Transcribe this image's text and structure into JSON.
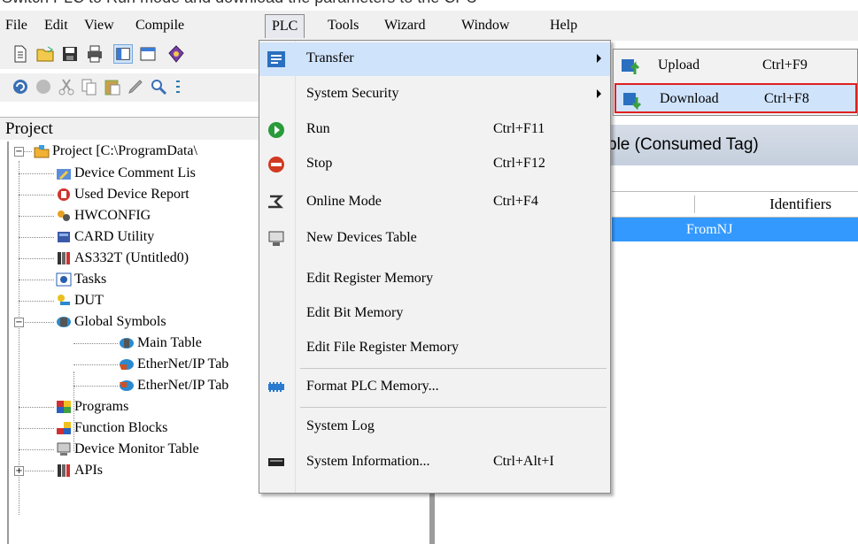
{
  "top_caption": "Switch PLC to Run mode and download the parameters to the CPU",
  "menubar": {
    "items": [
      "File",
      "Edit",
      "View",
      "Compile",
      "PLC",
      "Tools",
      "Wizard",
      "Window",
      "Help"
    ],
    "open_item": "PLC"
  },
  "project_panel": {
    "title": "Project",
    "tree": [
      {
        "label": "Project [C:\\ProgramData\\",
        "icon": "project-folder-icon"
      },
      {
        "label": "Device Comment Lis",
        "icon": "edit-comment-icon"
      },
      {
        "label": "Used Device Report",
        "icon": "report-icon"
      },
      {
        "label": "HWCONFIG",
        "icon": "hardware-config-icon"
      },
      {
        "label": "CARD Utility",
        "icon": "card-icon"
      },
      {
        "label": "AS332T  (Untitled0)",
        "icon": "plc-module-icon"
      },
      {
        "label": "Tasks",
        "icon": "tasks-icon"
      },
      {
        "label": "DUT",
        "icon": "dut-icon"
      },
      {
        "label": "Global Symbols",
        "icon": "global-symbols-icon"
      },
      {
        "label": "Main Table",
        "icon": "symbol-table-icon"
      },
      {
        "label": "EtherNet/IP Tab",
        "icon": "ethernet-ip-table-icon"
      },
      {
        "label": "EtherNet/IP Tab",
        "icon": "ethernet-ip-table-icon"
      },
      {
        "label": "Programs",
        "icon": "programs-icon"
      },
      {
        "label": "Function Blocks",
        "icon": "function-blocks-icon"
      },
      {
        "label": "Device Monitor Table",
        "icon": "monitor-table-icon"
      },
      {
        "label": "APIs",
        "icon": "apis-icon"
      }
    ]
  },
  "right_pane": {
    "header": "ble (Consumed Tag)",
    "column_header": "Identifiers",
    "selected_row": "FromNJ"
  },
  "plc_menu": {
    "items": [
      {
        "label": "Transfer",
        "shortcut": "",
        "icon": "transfer-icon",
        "submenu": true,
        "highlighted": true
      },
      {
        "label": "System Security",
        "shortcut": "",
        "icon": "",
        "submenu": true
      },
      {
        "label": "Run",
        "shortcut": "Ctrl+F11",
        "icon": "run-icon"
      },
      {
        "label": "Stop",
        "shortcut": "Ctrl+F12",
        "icon": "stop-icon"
      },
      {
        "label": "Online Mode",
        "shortcut": "Ctrl+F4",
        "icon": "online-mode-icon"
      },
      {
        "label": "New Devices Table",
        "shortcut": "",
        "icon": "new-devices-table-icon"
      },
      {
        "label": "Edit Register Memory",
        "shortcut": "",
        "icon": ""
      },
      {
        "label": "Edit Bit Memory",
        "shortcut": "",
        "icon": ""
      },
      {
        "label": "Edit File Register Memory",
        "shortcut": "",
        "icon": ""
      },
      {
        "label": "Format PLC Memory...",
        "shortcut": "",
        "icon": "format-memory-icon"
      },
      {
        "label": "System Log",
        "shortcut": "",
        "icon": ""
      },
      {
        "label": "System Information...",
        "shortcut": "Ctrl+Alt+I",
        "icon": "system-information-icon"
      }
    ]
  },
  "transfer_submenu": {
    "items": [
      {
        "label": "Upload",
        "shortcut": "Ctrl+F9",
        "icon": "upload-icon"
      },
      {
        "label": "Download",
        "shortcut": "Ctrl+F8",
        "icon": "download-icon",
        "focused": true
      }
    ]
  },
  "colors": {
    "menu_highlight": "#cfe3fa",
    "selection": "#3399ff",
    "focus_border": "#e02020"
  }
}
